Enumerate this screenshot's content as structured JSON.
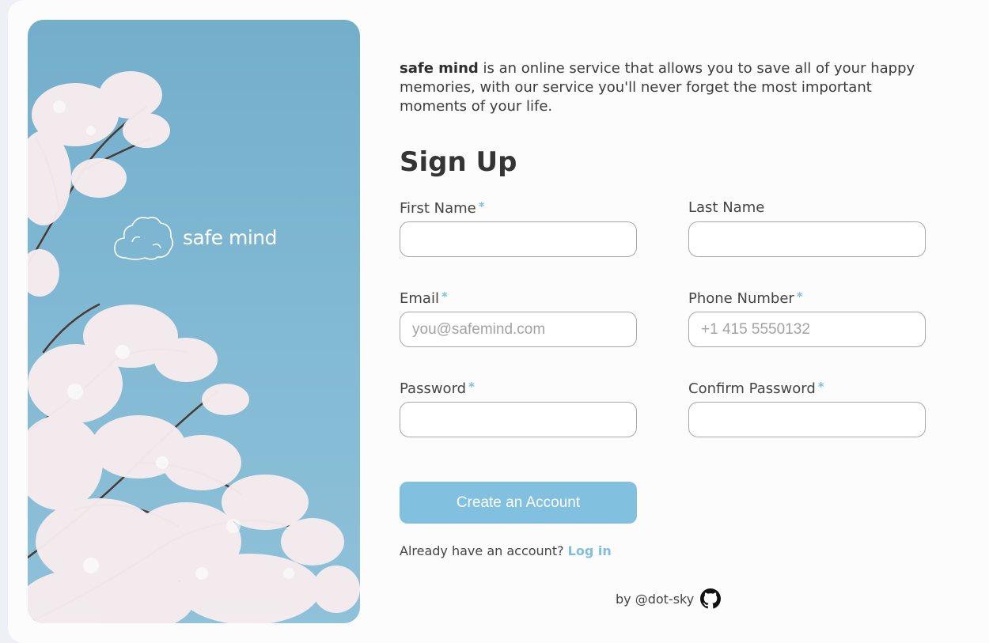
{
  "brand": {
    "name": "safe mind"
  },
  "intro": {
    "brand": "safe mind",
    "text": " is an online service that allows you to save all of your happy memories, with our service you'll never forget the most important moments of your life."
  },
  "form": {
    "title": "Sign Up",
    "required_mark": "*",
    "first_name": {
      "label": "First Name",
      "placeholder": "",
      "value": ""
    },
    "last_name": {
      "label": "Last Name",
      "placeholder": "",
      "value": ""
    },
    "email": {
      "label": "Email",
      "placeholder": "you@safemind.com",
      "value": ""
    },
    "phone": {
      "label": "Phone Number",
      "placeholder": "+1 415 5550132",
      "value": ""
    },
    "password": {
      "label": "Password",
      "placeholder": "",
      "value": ""
    },
    "confirm_password": {
      "label": "Confirm Password",
      "placeholder": "",
      "value": ""
    },
    "submit_label": "Create an Account"
  },
  "login": {
    "prompt": "Already have an account? ",
    "link_label": "Log in"
  },
  "footer": {
    "credit": "by @dot-sky",
    "icon": "github-icon"
  },
  "colors": {
    "accent": "#82c0e0",
    "sky": "#7ab3cf",
    "text": "#3c3c3c"
  }
}
